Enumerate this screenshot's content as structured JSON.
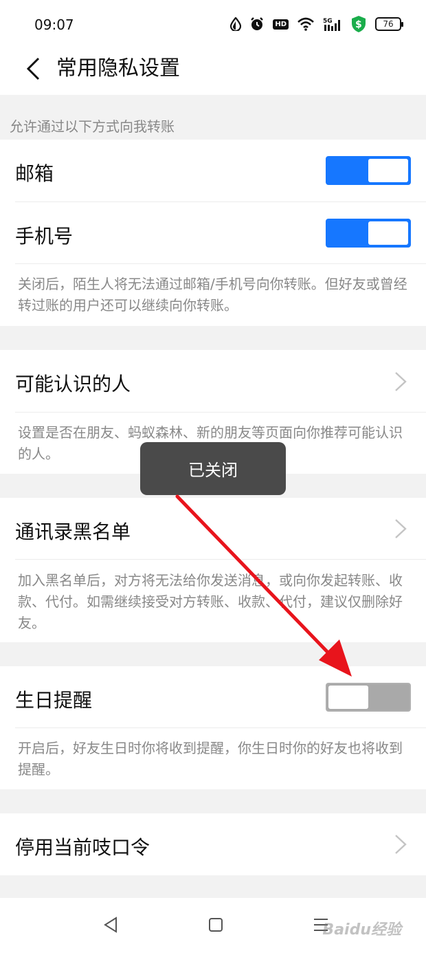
{
  "status": {
    "time": "09:07",
    "hd": "HD",
    "battery": "76",
    "signal_type": "5G"
  },
  "nav": {
    "title": "常用隐私设置"
  },
  "transfer": {
    "header": "允许通过以下方式向我转账",
    "email_label": "邮箱",
    "email_on": true,
    "phone_label": "手机号",
    "phone_on": true,
    "description": "关闭后，陌生人将无法通过邮箱/手机号向你转账。但好友或曾经转过账的用户还可以继续向你转账。"
  },
  "people": {
    "label": "可能认识的人",
    "description": "设置是否在朋友、蚂蚁森林、新的朋友等页面向你推荐可能认识的人。"
  },
  "blacklist": {
    "label": "通讯录黑名单",
    "description": "加入黑名单后，对方将无法给你发送消息，或向你发起转账、收款、代付。如需继续接受对方转账、收款、代付，建议仅删除好友。"
  },
  "birthday": {
    "label": "生日提醒",
    "on": false,
    "description": "开启后，好友生日时你将收到提醒，你生日时你的好友也将收到提醒。"
  },
  "password": {
    "label": "停用当前吱口令"
  },
  "toast": {
    "text": "已关闭"
  },
  "watermark": {
    "text": "Baidu经验"
  },
  "colors": {
    "accent": "#1677ff",
    "toggle_off": "#a9a9a9",
    "arrow": "#e8141c",
    "toast_bg": "#4a4a4a"
  },
  "icons": [
    "water-drop-icon",
    "alarm-icon",
    "hd-icon",
    "wifi-icon",
    "signal-icon",
    "shield-dollar-icon",
    "battery-icon",
    "back-chevron-icon",
    "chevron-right-icon",
    "triangle-back-icon",
    "square-home-icon",
    "menu-lines-icon"
  ]
}
